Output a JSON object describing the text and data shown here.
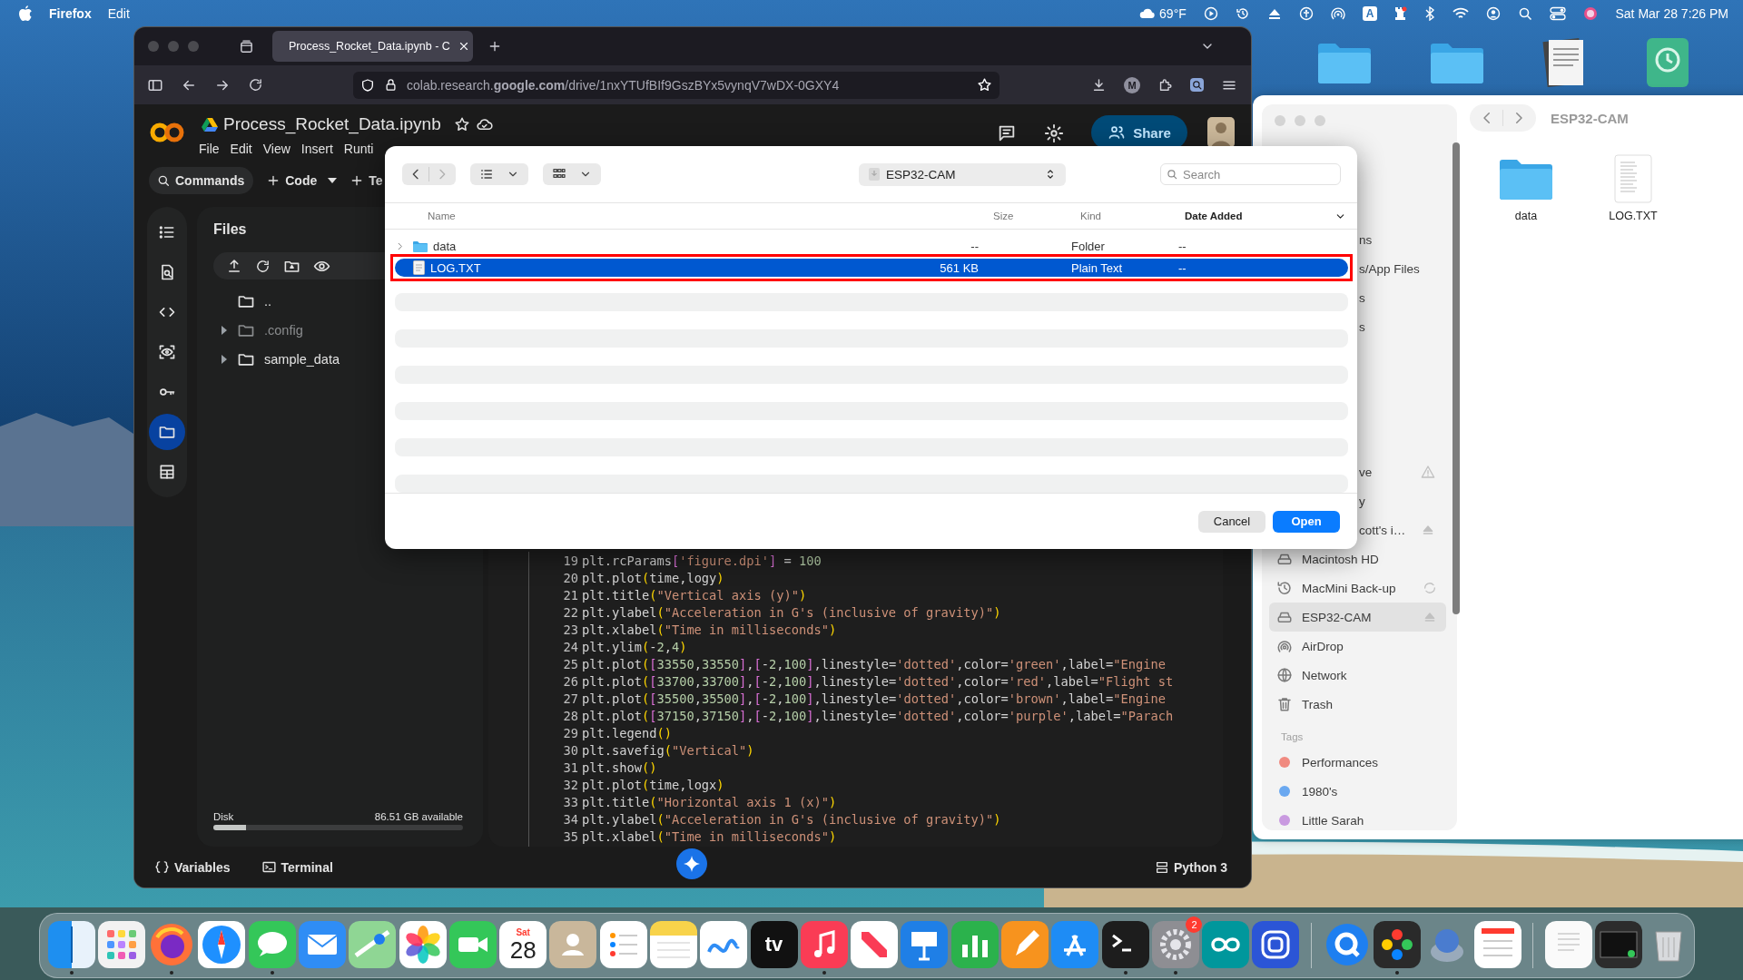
{
  "menu_bar": {
    "app": "Firefox",
    "menus": [
      "Edit"
    ],
    "weather": "69°F",
    "input_source": "A",
    "clock": "Sat Mar 28  7:26 PM"
  },
  "browser": {
    "tab_title": "Process_Rocket_Data.ipynb - C",
    "url": "colab.research.**google.com**/drive/1nxYTUfBIf9GszBYx5vynqV7wDX-0GXY4",
    "profile_initial": "M"
  },
  "colab": {
    "notebook_title": "Process_Rocket_Data.ipynb",
    "menus": [
      "File",
      "Edit",
      "View",
      "Insert",
      "Runti"
    ],
    "toolbar": {
      "commands": "Commands",
      "code": "Code",
      "text": "Te"
    },
    "share": "Share",
    "rail": [
      {
        "kind": "outline",
        "selected": false
      },
      {
        "kind": "find",
        "selected": false
      },
      {
        "kind": "code",
        "selected": false
      },
      {
        "kind": "vision",
        "selected": false
      },
      {
        "kind": "key",
        "selected": false
      },
      {
        "kind": "folder",
        "selected": true
      },
      {
        "kind": "table",
        "selected": false
      }
    ],
    "files": {
      "title": "Files",
      "tree": [
        {
          "name": "..",
          "expandable": false,
          "dimmed": false
        },
        {
          "name": ".config",
          "expandable": true,
          "dimmed": true
        },
        {
          "name": "sample_data",
          "expandable": true,
          "dimmed": false
        }
      ],
      "disk": {
        "label": "Disk",
        "available": "86.51 GB available",
        "level": 0.13
      }
    },
    "code_lines": [
      {
        "number": "19",
        "text": "plt.rcParams['figure.dpi'] = 100"
      },
      {
        "number": "20",
        "text": "plt.plot(time,logy)"
      },
      {
        "number": "21",
        "text": "plt.title(\"Vertical axis (y)\")"
      },
      {
        "number": "22",
        "text": "plt.ylabel(\"Acceleration in G's (inclusive of gravity)\")"
      },
      {
        "number": "23",
        "text": "plt.xlabel(\"Time in milliseconds\")"
      },
      {
        "number": "24",
        "text": "plt.ylim(-2,4)"
      },
      {
        "number": "25",
        "text": "plt.plot([33550,33550],[-2,100],linestyle='dotted',color='green',label=\"Engine"
      },
      {
        "number": "26",
        "text": "plt.plot([33700,33700],[-2,100],linestyle='dotted',color='red',label=\"Flight st"
      },
      {
        "number": "27",
        "text": "plt.plot([35500,35500],[-2,100],linestyle='dotted',color='brown',label=\"Engine"
      },
      {
        "number": "28",
        "text": "plt.plot([37150,37150],[-2,100],linestyle='dotted',color='purple',label=\"Parach"
      },
      {
        "number": "29",
        "text": "plt.legend()"
      },
      {
        "number": "30",
        "text": "plt.savefig(\"Vertical\")"
      },
      {
        "number": "31",
        "text": "plt.show()"
      },
      {
        "number": "32",
        "text": "plt.plot(time,logx)"
      },
      {
        "number": "33",
        "text": "plt.title(\"Horizontal axis 1 (x)\")"
      },
      {
        "number": "34",
        "text": "plt.ylabel(\"Acceleration in G's (inclusive of gravity)\")"
      },
      {
        "number": "35",
        "text": "plt.xlabel(\"Time in milliseconds\")"
      }
    ],
    "status": {
      "variables": "Variables",
      "terminal": "Terminal",
      "runtime": "Python 3"
    }
  },
  "open_dialog": {
    "location": "ESP32-CAM",
    "search_placeholder": "Search",
    "columns": [
      "Name",
      "Size",
      "Kind",
      "Date Added"
    ],
    "rows": [
      {
        "kind": "folder",
        "name": "data",
        "size": "--",
        "type": "Folder",
        "date": "--",
        "selected": false,
        "highlighted": false
      },
      {
        "kind": "file",
        "name": "LOG.TXT",
        "size": "561 KB",
        "type": "Plain Text",
        "date": "--",
        "selected": true,
        "highlighted": true
      }
    ],
    "cancel": "Cancel",
    "open": "Open"
  },
  "finder": {
    "title": "ESP32-CAM",
    "covered_top": [
      "ns",
      "s/App Files",
      "s",
      "s"
    ],
    "covered_bottom": [
      {
        "text": "ve",
        "warning": true,
        "ejectable": false
      },
      {
        "text": "y",
        "warning": false,
        "ejectable": false
      },
      {
        "text": "cott's i…",
        "warning": false,
        "ejectable": true
      }
    ],
    "locations": [
      {
        "kind": "disk",
        "name": "Macintosh HD",
        "selected": false,
        "ejectable": false,
        "syncing": false
      },
      {
        "kind": "backup",
        "name": "MacMini Back-up",
        "selected": false,
        "ejectable": false,
        "syncing": true
      },
      {
        "kind": "disk",
        "name": "ESP32-CAM",
        "selected": true,
        "ejectable": true,
        "syncing": false
      },
      {
        "kind": "airdrop",
        "name": "AirDrop",
        "selected": false,
        "ejectable": false,
        "syncing": false
      },
      {
        "kind": "network",
        "name": "Network",
        "selected": false,
        "ejectable": false,
        "syncing": false
      },
      {
        "kind": "trash",
        "name": "Trash",
        "selected": false,
        "ejectable": false,
        "syncing": false
      }
    ],
    "tags_heading": "Tags",
    "tags": [
      {
        "name": "Performances",
        "color": "#f08a80"
      },
      {
        "name": "1980's",
        "color": "#6aa8f0"
      },
      {
        "name": "Little Sarah",
        "color": "#c99ae0"
      }
    ],
    "items": [
      {
        "kind": "folder",
        "name": "data"
      },
      {
        "kind": "text-file",
        "name": "LOG.TXT"
      }
    ]
  },
  "dock": {
    "apps": [
      {
        "kind": "finder",
        "running": true
      },
      {
        "kind": "launchpad",
        "running": false
      },
      {
        "kind": "firefox",
        "running": true
      },
      {
        "kind": "safari",
        "running": false
      },
      {
        "kind": "messages",
        "running": true
      },
      {
        "kind": "mail",
        "running": false
      },
      {
        "kind": "maps",
        "running": false
      },
      {
        "kind": "photos",
        "running": false
      },
      {
        "kind": "facetime",
        "running": false
      },
      {
        "kind": "calendar",
        "running": false,
        "month": "Sat",
        "day": "28"
      },
      {
        "kind": "contacts",
        "running": false
      },
      {
        "kind": "reminders",
        "running": false
      },
      {
        "kind": "notes",
        "running": false
      },
      {
        "kind": "freeform",
        "running": false
      },
      {
        "kind": "tv",
        "running": false,
        "label": "tv"
      },
      {
        "kind": "music",
        "running": true
      },
      {
        "kind": "news",
        "running": false
      },
      {
        "kind": "keynote",
        "running": false
      },
      {
        "kind": "numbers",
        "running": false
      },
      {
        "kind": "pages",
        "running": false
      },
      {
        "kind": "appstore",
        "running": false
      },
      {
        "kind": "terminal",
        "running": true
      },
      {
        "kind": "settings",
        "running": true,
        "badge": "2"
      },
      {
        "kind": "arduino",
        "running": false
      },
      {
        "kind": "rings",
        "running": false
      }
    ],
    "recent": [
      {
        "kind": "qapp",
        "running": false
      },
      {
        "kind": "controller",
        "running": true
      },
      {
        "kind": "disk",
        "running": false
      },
      {
        "kind": "sheet",
        "running": false
      }
    ],
    "stack": [
      {
        "kind": "document",
        "running": false
      },
      {
        "kind": "screenshot",
        "running": false
      },
      {
        "kind": "trash",
        "running": false
      }
    ]
  }
}
